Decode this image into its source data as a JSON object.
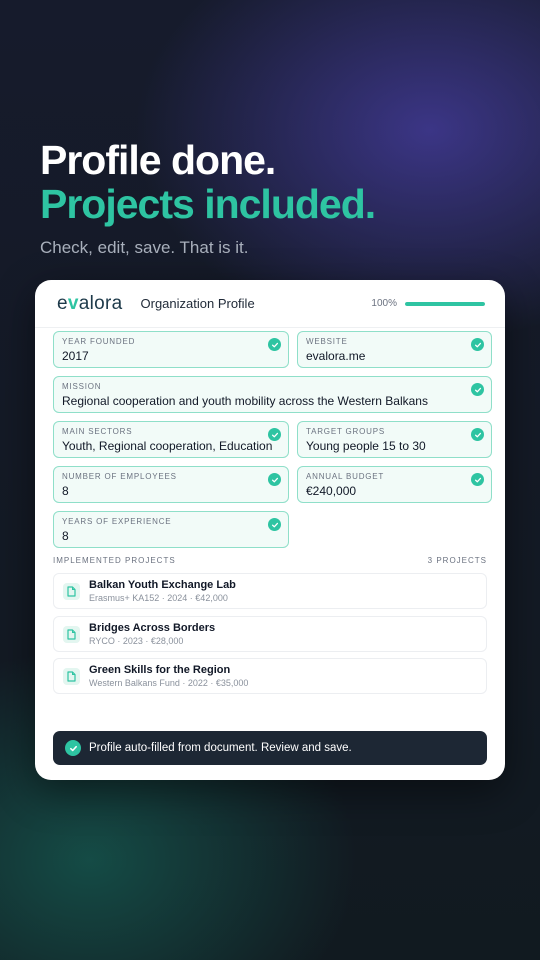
{
  "hero": {
    "line1": "Profile done.",
    "line2": "Projects included.",
    "tagline": "Check, edit, save. That is it."
  },
  "card": {
    "logo_prefix": "e",
    "logo_v": "v",
    "logo_suffix": "alora",
    "title": "Organization Profile",
    "progress_label": "100%",
    "progress_fraction": 1.0
  },
  "fields": [
    {
      "label": "YEAR FOUNDED",
      "value": "2017"
    },
    {
      "label": "WEBSITE",
      "value": "evalora.me"
    },
    {
      "label": "MISSION",
      "value": "Regional cooperation and youth mobility across the Western Balkans"
    },
    {
      "label": "MAIN SECTORS",
      "value": "Youth, Regional cooperation, Education"
    },
    {
      "label": "TARGET GROUPS",
      "value": "Young people 15 to 30"
    },
    {
      "label": "NUMBER OF EMPLOYEES",
      "value": "8"
    },
    {
      "label": "ANNUAL BUDGET",
      "value": "€240,000"
    },
    {
      "label": "YEARS OF EXPERIENCE",
      "value": "8"
    }
  ],
  "projects": {
    "heading": "IMPLEMENTED PROJECTS",
    "count": "3 PROJECTS",
    "items": [
      {
        "name": "Balkan Youth Exchange Lab",
        "meta": "Erasmus+ KA152 · 2024 · €42,000"
      },
      {
        "name": "Bridges Across Borders",
        "meta": "RYCO · 2023 · €28,000"
      },
      {
        "name": "Green Skills for the Region",
        "meta": "Western Balkans Fund · 2022 · €35,000"
      }
    ]
  },
  "toast": {
    "text": "Profile auto-filled from document. Review and save."
  },
  "colors": {
    "accent": "#2ec4a2",
    "field_border": "#8fdfc9",
    "toast_bg": "#1d2734"
  },
  "icons": {
    "field_status": "check-circle-icon",
    "project": "document-icon",
    "toast": "check-circle-icon"
  }
}
